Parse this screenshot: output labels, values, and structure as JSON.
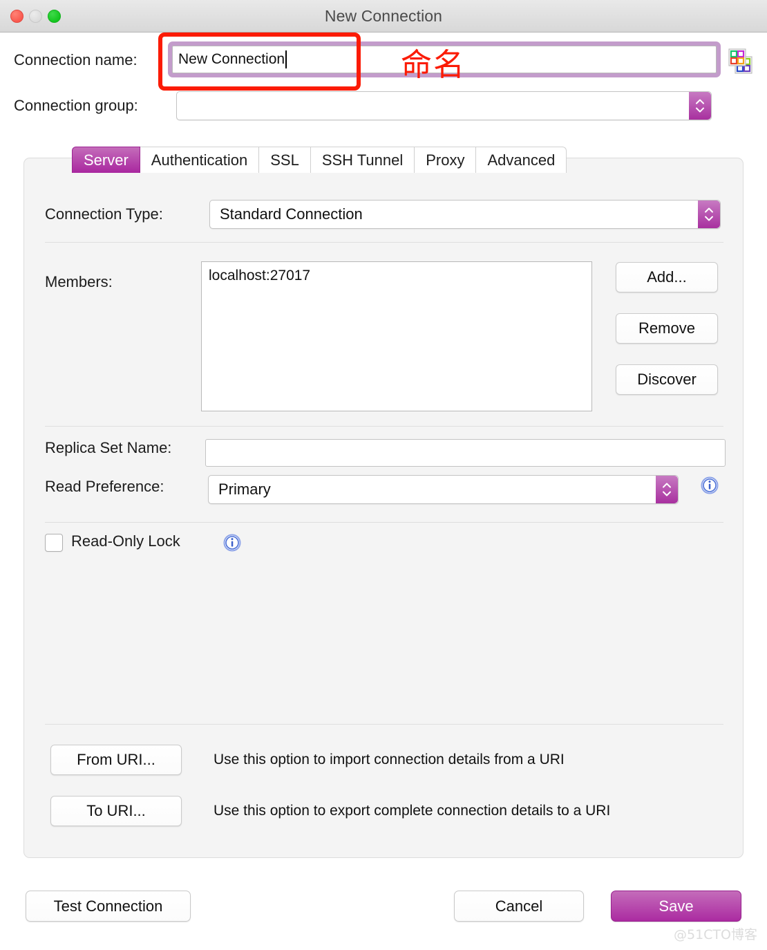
{
  "window": {
    "title": "New Connection",
    "traffic_lights": [
      "close",
      "minimize",
      "maximize"
    ]
  },
  "top_form": {
    "connection_name_label": "Connection name:",
    "connection_name_value": "New Connection",
    "connection_group_label": "Connection group:",
    "connection_group_value": "",
    "palette_icon": "color-palette-icon"
  },
  "tabs": [
    {
      "label": "Server",
      "active": true
    },
    {
      "label": "Authentication",
      "active": false
    },
    {
      "label": "SSL",
      "active": false
    },
    {
      "label": "SSH Tunnel",
      "active": false
    },
    {
      "label": "Proxy",
      "active": false
    },
    {
      "label": "Advanced",
      "active": false
    }
  ],
  "server_tab": {
    "connection_type_label": "Connection Type:",
    "connection_type_value": "Standard Connection",
    "connection_type_options": [
      "Standard Connection"
    ],
    "members_label": "Members:",
    "members": [
      "localhost:27017"
    ],
    "member_buttons": [
      {
        "label": "Add...",
        "name": "add-member-button"
      },
      {
        "label": "Remove",
        "name": "remove-member-button"
      },
      {
        "label": "Discover",
        "name": "discover-members-button"
      }
    ],
    "replica_set_label": "Replica Set Name:",
    "replica_set_value": "",
    "read_preference_label": "Read Preference:",
    "read_preference_value": "Primary",
    "read_preference_options": [
      "Primary"
    ],
    "read_only_lock_label": "Read-Only Lock",
    "read_only_lock_checked": false,
    "uri": {
      "from_label": "From URI...",
      "from_desc": "Use this option to import connection details from a URI",
      "to_label": "To URI...",
      "to_desc": "Use this option to export complete connection details to a URI"
    }
  },
  "footer": {
    "test_connection": "Test Connection",
    "cancel": "Cancel",
    "save": "Save"
  },
  "annotations": {
    "highlight_text": "命名",
    "highlight_color": "#fb1b05",
    "watermark": "@51CTO博客"
  },
  "colors": {
    "accent": "#ab2ba1",
    "accent_light": "#c46cba",
    "focus_ring": "#c39ccb",
    "panel_bg": "#f4f4f4",
    "info_blue": "#4a6fd6"
  }
}
